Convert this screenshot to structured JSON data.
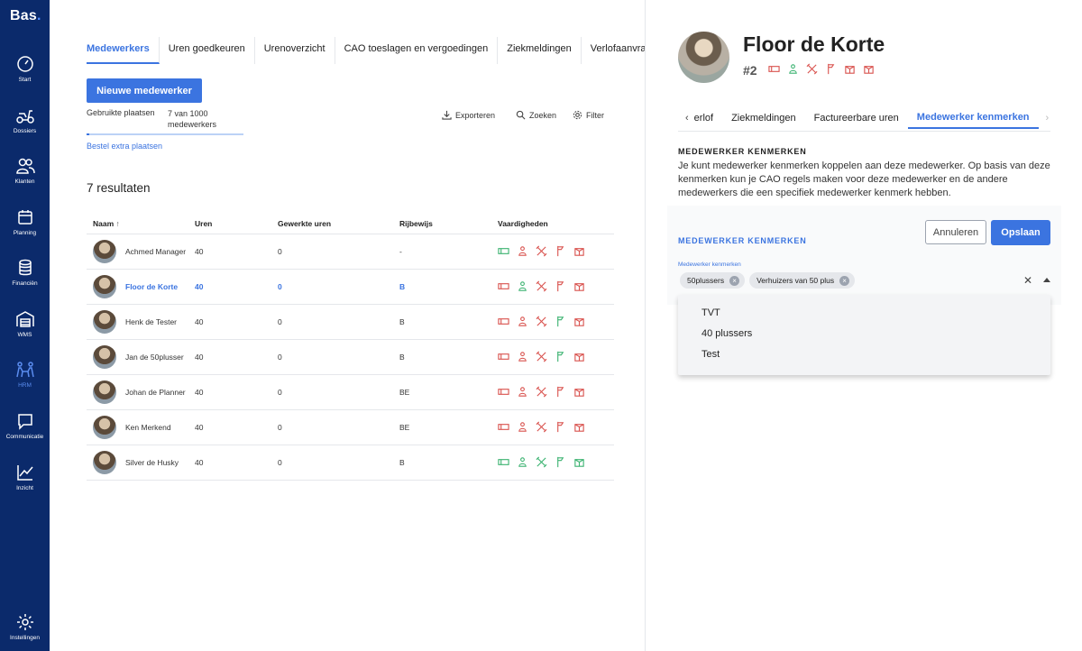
{
  "app": {
    "logo": "Bas",
    "logo_dot": "."
  },
  "sidebar": {
    "items": [
      {
        "label": "Start",
        "icon": "gauge-icon"
      },
      {
        "label": "Dossiers",
        "icon": "scooter-icon"
      },
      {
        "label": "Klanten",
        "icon": "users-icon"
      },
      {
        "label": "Planning",
        "icon": "calendar-icon"
      },
      {
        "label": "Financiën",
        "icon": "coins-icon"
      },
      {
        "label": "WMS",
        "icon": "warehouse-icon"
      },
      {
        "label": "HRM",
        "icon": "people-icon",
        "active": true
      },
      {
        "label": "Communicatie",
        "icon": "chat-icon"
      },
      {
        "label": "Inzicht",
        "icon": "chart-icon"
      },
      {
        "label": "Instellingen",
        "icon": "gear-icon"
      }
    ]
  },
  "main": {
    "tabs": [
      "Medewerkers",
      "Uren goedkeuren",
      "Urenoverzicht",
      "CAO toeslagen en vergoedingen",
      "Ziekmeldingen",
      "Verlofaanvragen"
    ],
    "new_button": "Nieuwe medewerker",
    "used_label": "Gebruikte plaatsen",
    "used_value": "7 van 1000 medewerkers",
    "used_fraction": 0.007,
    "extra_link": "Bestel extra plaatsen",
    "tools": {
      "export": "Exporteren",
      "search": "Zoeken",
      "filter": "Filter"
    },
    "results": "7 resultaten",
    "columns": [
      "Naam",
      "Uren",
      "Gewerkte uren",
      "Rijbewijs",
      "Vaardigheden"
    ],
    "rows": [
      {
        "name": "Achmed Manager",
        "hours": "40",
        "worked": "0",
        "license": "-",
        "skills": [
          "g",
          "r",
          "r",
          "r",
          "r"
        ]
      },
      {
        "name": "Floor de Korte",
        "hours": "40",
        "worked": "0",
        "license": "B",
        "skills": [
          "r",
          "g",
          "r",
          "r",
          "r"
        ],
        "selected": true
      },
      {
        "name": "Henk de Tester",
        "hours": "40",
        "worked": "0",
        "license": "B",
        "skills": [
          "r",
          "r",
          "r",
          "g",
          "r"
        ]
      },
      {
        "name": "Jan de 50plusser",
        "hours": "40",
        "worked": "0",
        "license": "B",
        "skills": [
          "r",
          "r",
          "r",
          "g",
          "r"
        ]
      },
      {
        "name": "Johan de Planner",
        "hours": "40",
        "worked": "0",
        "license": "BE",
        "skills": [
          "r",
          "r",
          "r",
          "r",
          "r"
        ]
      },
      {
        "name": "Ken Merkend",
        "hours": "40",
        "worked": "0",
        "license": "BE",
        "skills": [
          "r",
          "r",
          "r",
          "r",
          "r"
        ]
      },
      {
        "name": "Silver de Husky",
        "hours": "40",
        "worked": "0",
        "license": "B",
        "skills": [
          "g",
          "g",
          "g",
          "g",
          "g"
        ]
      }
    ]
  },
  "panel": {
    "name": "Floor de Korte",
    "id": "#2",
    "tabs": [
      "erlof",
      "Ziekmeldingen",
      "Factureerbare uren",
      "Medewerker kenmerken"
    ],
    "section_title": "MEDEWERKER KENMERKEN",
    "description": "Je kunt medewerker kenmerken koppelen aan deze medewerker. Op basis van deze kenmerken kun je CAO regels maken voor deze medewerker en de andere medewerkers die een specifiek medewerker kenmerk hebben.",
    "card_title": "MEDEWERKER KENMERKEN",
    "cancel": "Annuleren",
    "save": "Opslaan",
    "field_label": "Medewerker kenmerken",
    "chips": [
      "50plussers",
      "Verhuizers van 50 plus"
    ],
    "options": [
      "TVT",
      "40 plussers",
      "Test"
    ]
  },
  "colors": {
    "accent": "#3b74e0",
    "sidebar": "#0b2a6b",
    "green": "#3cb371",
    "red": "#d9534f"
  }
}
